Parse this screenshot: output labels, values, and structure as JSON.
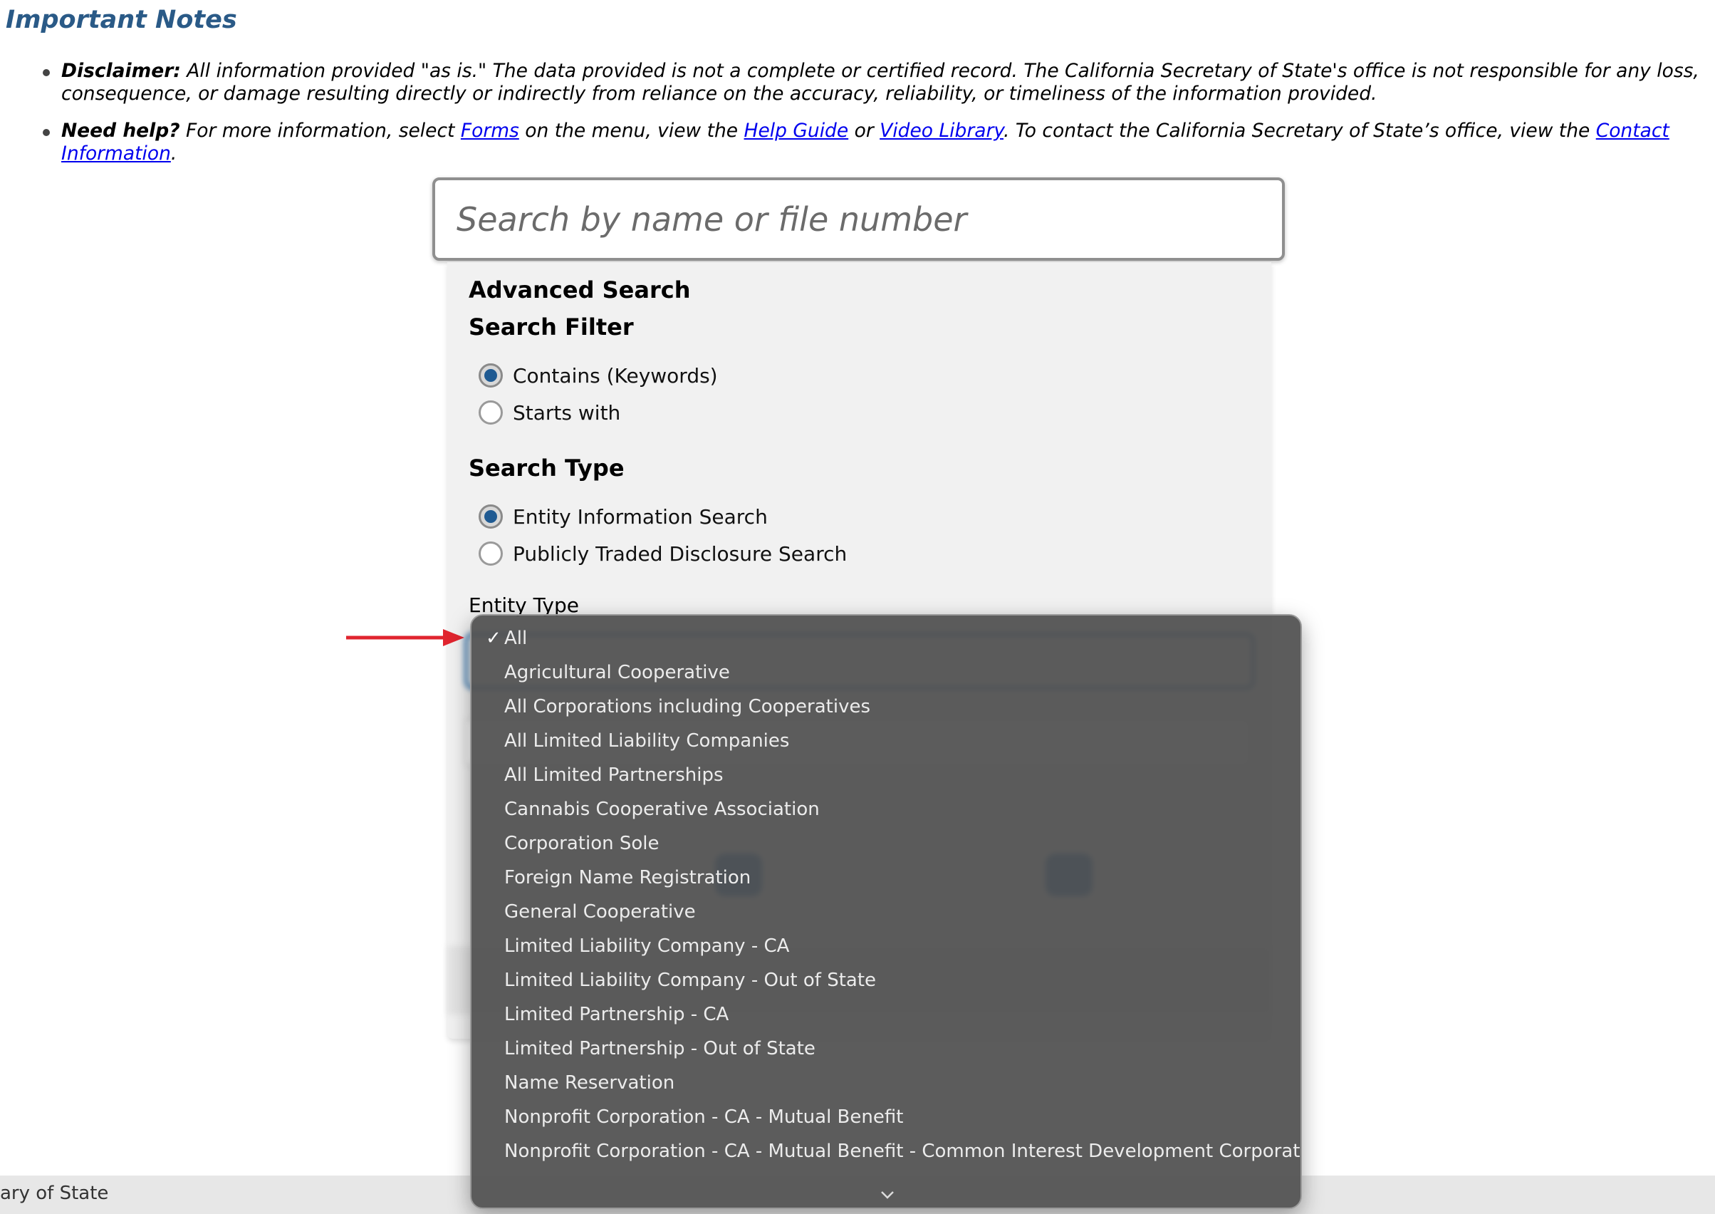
{
  "notes": {
    "title": "Important Notes",
    "disclaimer_label": "Disclaimer:",
    "disclaimer_text": " All information provided \"as is.\" The data provided is not a complete or certified record. The California Secretary of State's office is not responsible for any loss, consequence, or damage resulting directly or indirectly from reliance on the accuracy, reliability, or timeliness of the information provided.",
    "help_label": "Need help?",
    "help_text_1": " For more information, select ",
    "help_link_forms": "Forms",
    "help_text_2": " on the menu, view the ",
    "help_link_guide": "Help Guide",
    "help_text_3": " or ",
    "help_link_video": "Video Library",
    "help_text_4": ". To contact the California Secretary of State’s office, view the ",
    "help_link_contact": "Contact Information",
    "help_text_5": "."
  },
  "search": {
    "placeholder": "Search by name or file number",
    "value": ""
  },
  "advanced": {
    "title": "Advanced Search",
    "filter_title": "Search Filter",
    "filter_options": [
      {
        "label": "Contains (Keywords)",
        "checked": true
      },
      {
        "label": "Starts with",
        "checked": false
      }
    ],
    "type_title": "Search Type",
    "type_options": [
      {
        "label": "Entity Information Search",
        "checked": true
      },
      {
        "label": "Publicly Traded Disclosure Search",
        "checked": false
      }
    ],
    "entity_type_label": "Entity Type"
  },
  "entity_dropdown": {
    "selected": "All",
    "options": [
      "All",
      "Agricultural Cooperative",
      "All Corporations including Cooperatives",
      "All Limited Liability Companies",
      "All Limited Partnerships",
      "Cannabis Cooperative Association",
      "Corporation Sole",
      "Foreign Name Registration",
      "General Cooperative",
      "Limited Liability Company - CA",
      "Limited Liability Company - Out of State",
      "Limited Partnership - CA",
      "Limited Partnership - Out of State",
      "Name Reservation",
      "Nonprofit Corporation - CA - Mutual Benefit",
      "Nonprofit Corporation - CA - Mutual Benefit - Common Interest Development Corporation"
    ]
  },
  "footer": {
    "text": "ary of State"
  },
  "colors": {
    "heading_blue": "#2a5a87",
    "radio_blue": "#1f5a92",
    "link": "#0000ee",
    "arrow_red": "#e0242e"
  },
  "icons": {
    "check": "check-icon",
    "chevron": "chevron-down-icon",
    "arrow": "red-arrow-icon"
  }
}
